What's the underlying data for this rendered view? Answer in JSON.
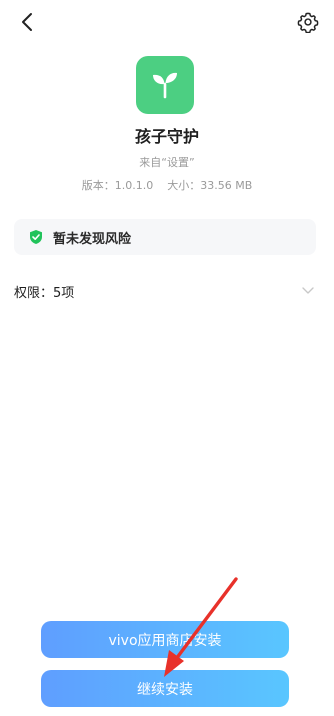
{
  "header": {
    "back_icon": "back-arrow-icon",
    "settings_icon": "gear-icon"
  },
  "app": {
    "icon": "sprout-icon",
    "icon_bg": "#4ccf82",
    "name": "孩子守护",
    "source": "来自“设置”",
    "version_label": "版本：1.0.1.0",
    "size_label": "大小：33.56 MB"
  },
  "risk": {
    "icon": "shield-check-icon",
    "icon_color": "#21c35b",
    "text": "暂未发现风险"
  },
  "permissions": {
    "label": "权限：5项",
    "chevron_icon": "chevron-down-icon"
  },
  "buttons": {
    "store_install": "vivo应用商店安装",
    "continue_install": "继续安装",
    "gradient_start": "#5f9eff",
    "gradient_end": "#59c6ff"
  },
  "annotation": {
    "arrow_color": "#e8312a"
  }
}
